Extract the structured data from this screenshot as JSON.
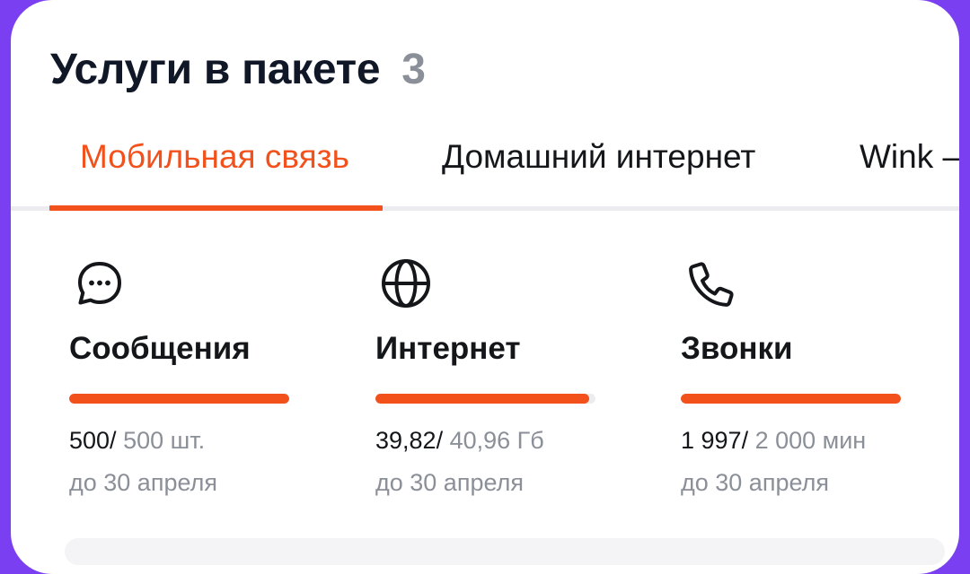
{
  "header": {
    "title": "Услуги в пакете",
    "count": "3"
  },
  "tabs": [
    {
      "label": "Мобильная связь",
      "active": true
    },
    {
      "label": "Домашний интернет",
      "active": false
    },
    {
      "label": "Wink –",
      "active": false
    }
  ],
  "services": [
    {
      "icon": "chat-bubble-icon",
      "title": "Сообщения",
      "used": "500/",
      "total": " 500 шт.",
      "until": "до 30 апреля",
      "progress": 1.0
    },
    {
      "icon": "globe-icon",
      "title": "Интернет",
      "used": "39,82/",
      "total": " 40,96 Гб",
      "until": "до 30 апреля",
      "progress": 0.972
    },
    {
      "icon": "phone-icon",
      "title": "Звонки",
      "used": "1 997/",
      "total": " 2 000 мин",
      "until": "до 30 апреля",
      "progress": 0.9985
    }
  ],
  "colors": {
    "accent": "#f2511b",
    "text": "#14161a",
    "muted": "#8b8f98",
    "frame": "#7a3ff0"
  }
}
